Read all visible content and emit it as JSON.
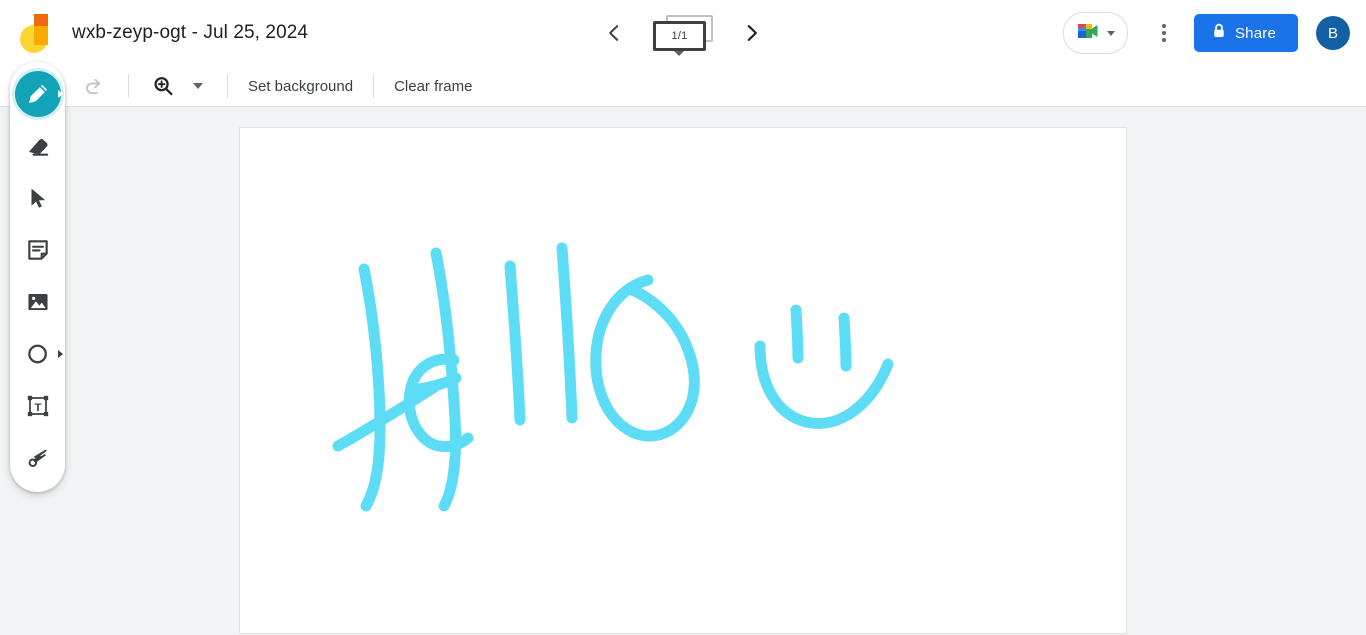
{
  "app": {
    "name": "Jamboard",
    "logo_icon": "jamboard-logo"
  },
  "header": {
    "title": "wxb-zeyp-ogt - Jul 25, 2024",
    "prev_frame_icon": "chevron-left-icon",
    "next_frame_icon": "chevron-right-icon",
    "frame_counter": "1/1",
    "frame_caret_icon": "caret-down-icon",
    "meet": {
      "icon": "google-meet-icon",
      "caret_icon": "caret-down-icon"
    },
    "more_options_icon": "kebab-menu-icon",
    "share": {
      "label": "Share",
      "icon": "lock-icon",
      "color": "#1a73e8"
    },
    "avatar": {
      "initial": "B",
      "color": "#1360a4"
    }
  },
  "toolbar": {
    "undo_icon": "undo-icon",
    "redo_icon": "redo-icon",
    "zoom_icon": "zoom-in-icon",
    "zoom_caret_icon": "caret-down-icon",
    "set_background_label": "Set background",
    "clear_frame_label": "Clear frame"
  },
  "tools": {
    "active_index": 0,
    "items": [
      {
        "name": "pen",
        "icon": "pen-icon",
        "has_submenu": true,
        "active": true
      },
      {
        "name": "eraser",
        "icon": "eraser-icon",
        "has_submenu": false,
        "active": false
      },
      {
        "name": "select",
        "icon": "cursor-select-icon",
        "has_submenu": false,
        "active": false
      },
      {
        "name": "sticky-note",
        "icon": "sticky-note-icon",
        "has_submenu": false,
        "active": false
      },
      {
        "name": "image",
        "icon": "image-icon",
        "has_submenu": false,
        "active": false
      },
      {
        "name": "shape",
        "icon": "circle-shape-icon",
        "has_submenu": true,
        "active": false
      },
      {
        "name": "text-box",
        "icon": "text-box-icon",
        "has_submenu": false,
        "active": false
      },
      {
        "name": "laser-pointer",
        "icon": "laser-pointer-icon",
        "has_submenu": false,
        "active": false
      }
    ]
  },
  "canvas": {
    "background": "#ffffff",
    "stage_background": "#f1f3f4",
    "drawing": {
      "text": "Hello",
      "stroke_color": "#5ddcf6",
      "description": "handwritten Hello with smiley face"
    }
  }
}
